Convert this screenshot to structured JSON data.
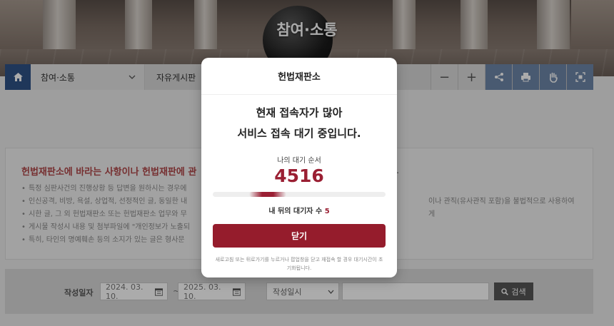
{
  "hero": {
    "title": "참여·소통"
  },
  "nav": {
    "home_icon": "home-icon",
    "crumb_label": "참여·소통",
    "sub_label": "자유게시판",
    "tools": [
      {
        "name": "zoom-out-icon",
        "glyph": "−"
      },
      {
        "name": "zoom-in-icon",
        "glyph": "+"
      },
      {
        "name": "share-icon"
      },
      {
        "name": "print-icon"
      },
      {
        "name": "hand-icon"
      },
      {
        "name": "scan-icon"
      }
    ]
  },
  "notice": {
    "title": "헌법재판소에 바라는 사항이나 헌법재판에 관",
    "title_tail": ".",
    "items": [
      {
        "left": "특정 심판사건의 진행상황 등 답변을 원하시는 경우에",
        "right": ""
      },
      {
        "left": "인신공격, 비방, 욕설, 상업적, 선정적인 글, 동일한 내",
        "right": "이나 관직(유사관직 포함)을 불법적으로 사용하여 게"
      },
      {
        "left": "시한 글, 그 외 헌법재판소 또는 헌법재판소 업무와 무",
        "right": ""
      },
      {
        "left": "게시물 작성시 내용 및 첨부파일에 \"개인정보가 노출되",
        "right": ""
      },
      {
        "left": "특히, 타인의 명예훼손 등의 소지가 있는 글은 형사문",
        "right": ""
      }
    ]
  },
  "search": {
    "label": "작성일자",
    "date_from": "2024. 03. 10.",
    "date_to": "2025. 03. 10.",
    "tilde": "~",
    "sort_value": "작성일시",
    "keyword_value": "",
    "button_label": "검색"
  },
  "modal": {
    "title": "헌법재판소",
    "message_line1": "현재 접속자가 많아",
    "message_line2": "서비스 접속 대기 중입니다.",
    "queue_label": "나의 대기 순서",
    "queue_number": "4516",
    "behind_label": "내 뒤의 대기자 수",
    "behind_count": "5",
    "progress_fraction": 0.21,
    "close_label": "닫기",
    "note": "새로고침 또는 뒤로가기를 누르거나 팝업창을 닫고 재접속 할 경우 대기시간이 초기화됩니다."
  },
  "colors": {
    "accent": "#951c2c",
    "queue_number": "#9a1f33",
    "nav_home": "#2f5387",
    "notice_title": "#b04648"
  }
}
